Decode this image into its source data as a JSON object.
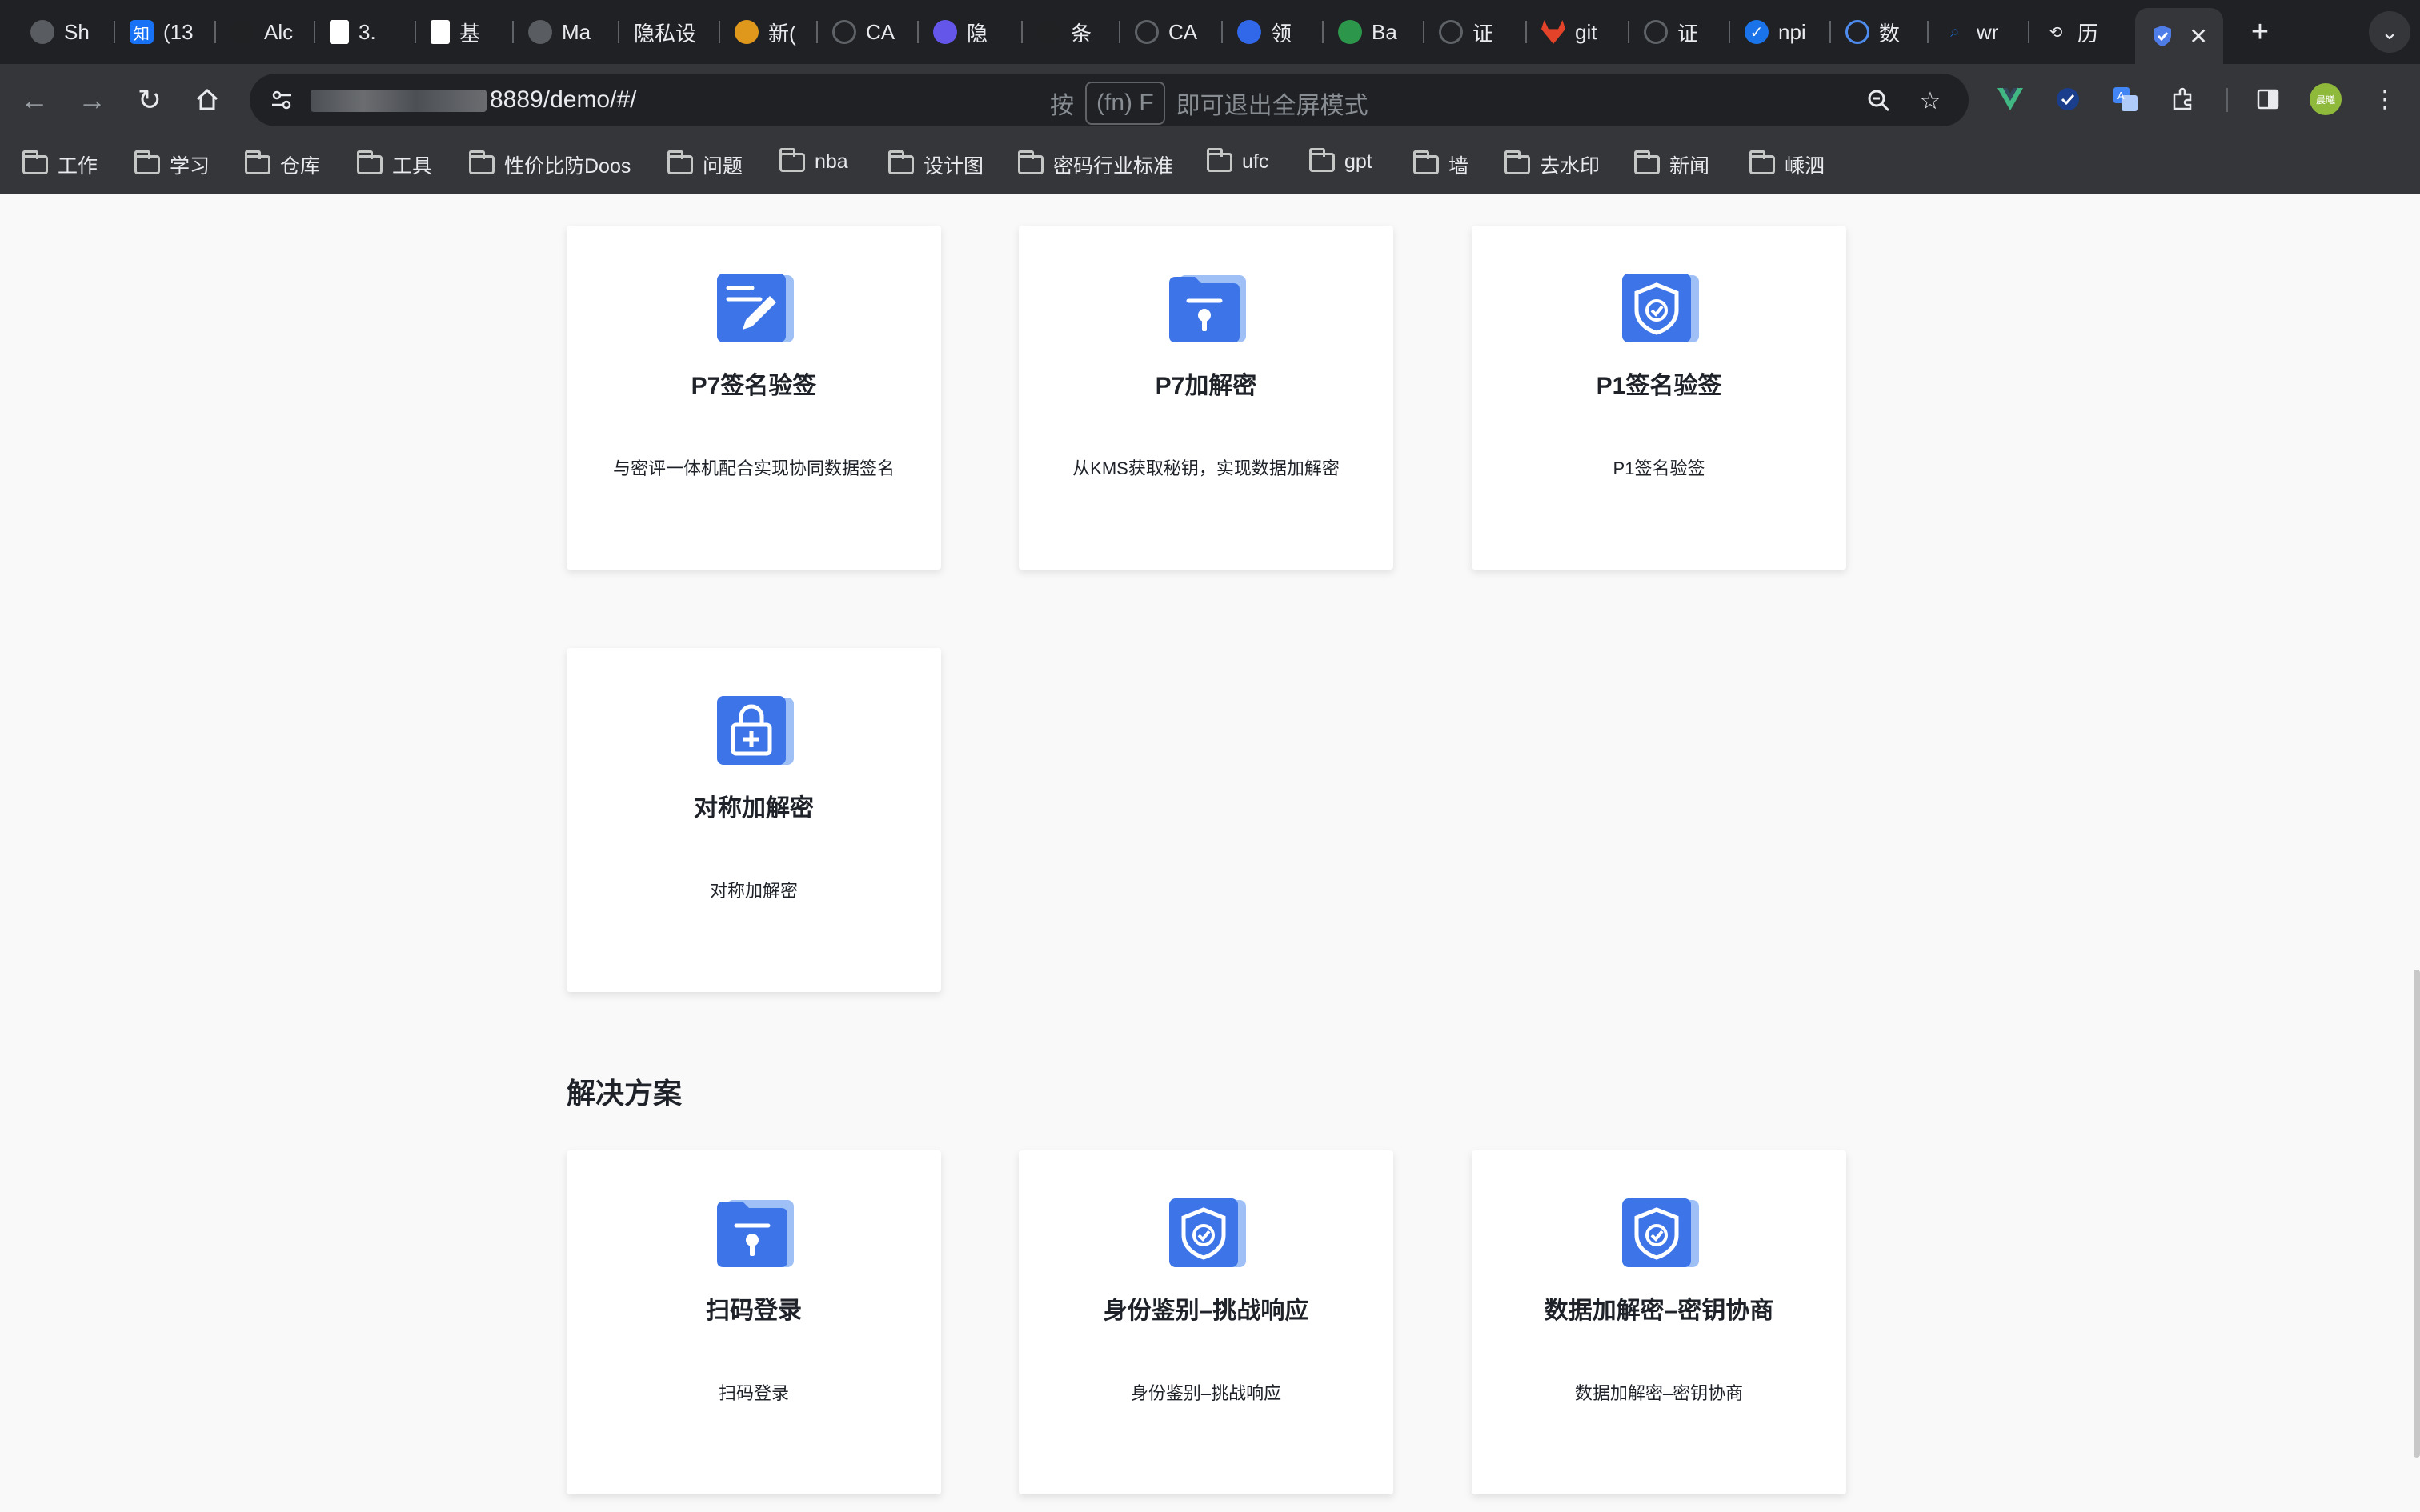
{
  "tabs": [
    {
      "label": "Sh",
      "icon": "sparkle-icon",
      "color": "#5f6368"
    },
    {
      "label": "(13",
      "icon": "zhihu-icon",
      "color": "#1772f6",
      "glyph": "知"
    },
    {
      "label": "Alc",
      "icon": "openai-icon",
      "color": "#202124"
    },
    {
      "label": "3.",
      "icon": "document-icon",
      "color": "#ffffff"
    },
    {
      "label": "基",
      "icon": "document-icon",
      "color": "#ffffff"
    },
    {
      "label": "Ma",
      "icon": "sparkle-icon",
      "color": "#5f6368"
    },
    {
      "label": "隐私设",
      "icon": "",
      "color": ""
    },
    {
      "label": "新(",
      "icon": "brand-icon",
      "color": "#f4a51c"
    },
    {
      "label": "CA",
      "icon": "globe-icon",
      "color": "#5f6368"
    },
    {
      "label": "隐",
      "icon": "arc-icon",
      "color": "#6b5cff"
    },
    {
      "label": "条",
      "icon": "bird-icon",
      "color": "#202124"
    },
    {
      "label": "CA",
      "icon": "globe-icon",
      "color": "#5f6368"
    },
    {
      "label": "领",
      "icon": "layers-icon",
      "color": "#3370ff"
    },
    {
      "label": "Ba",
      "icon": "t-icon",
      "color": "#2ea44f"
    },
    {
      "label": "证",
      "icon": "globe-icon",
      "color": "#5f6368"
    },
    {
      "label": "git",
      "icon": "gitlab-icon",
      "color": "#e24329"
    },
    {
      "label": "证",
      "icon": "globe-icon",
      "color": "#5f6368"
    },
    {
      "label": "npi",
      "icon": "check-circle-icon",
      "color": "#1a73e8"
    },
    {
      "label": "数",
      "icon": "globe-icon",
      "color": "#4e8cf0"
    },
    {
      "label": "wr",
      "icon": "search-icon",
      "color": "#1a73e8"
    },
    {
      "label": "历",
      "icon": "history-icon",
      "color": "#e8eaed"
    }
  ],
  "toolbar": {
    "url": "8889/demo/#/",
    "fs_hint_prefix": "按",
    "fs_hint_key": "(fn) F",
    "fs_hint_suffix": "即可退出全屏模式",
    "profile_label": "晨曦"
  },
  "bookmarks": [
    "工作",
    "学习",
    "仓库",
    "工具",
    "性价比防Doos",
    "问题",
    "nba",
    "设计图",
    "密码行业标准",
    "ufc",
    "gpt",
    "墙",
    "去水印",
    "新闻",
    "嵊泗"
  ],
  "cards_top": [
    {
      "title": "P7签名验签",
      "desc": "与密评一体机配合实现协同数据签名",
      "icon": "pen-icon"
    },
    {
      "title": "P7加解密",
      "desc": "从KMS获取秘钥，实现数据加解密",
      "icon": "folder-key-icon"
    },
    {
      "title": "P1签名验签",
      "desc": "P1签名验签",
      "icon": "shield-check-icon"
    },
    {
      "title": "对称加解密",
      "desc": "对称加解密",
      "icon": "lock-icon"
    }
  ],
  "section": {
    "title": "解决方案"
  },
  "cards_solution": [
    {
      "title": "扫码登录",
      "desc": "扫码登录",
      "icon": "folder-key-icon"
    },
    {
      "title": "身份鉴别–挑战响应",
      "desc": "身份鉴别–挑战响应",
      "icon": "shield-check-icon"
    },
    {
      "title": "数据加解密–密钥协商",
      "desc": "数据加解密–密钥协商",
      "icon": "shield-check-icon"
    }
  ],
  "colors": {
    "icon_blue": "#3d74e8",
    "icon_light": "#9ec0f7",
    "card_bg": "#ffffff",
    "page_bg": "#f9f9f9"
  }
}
